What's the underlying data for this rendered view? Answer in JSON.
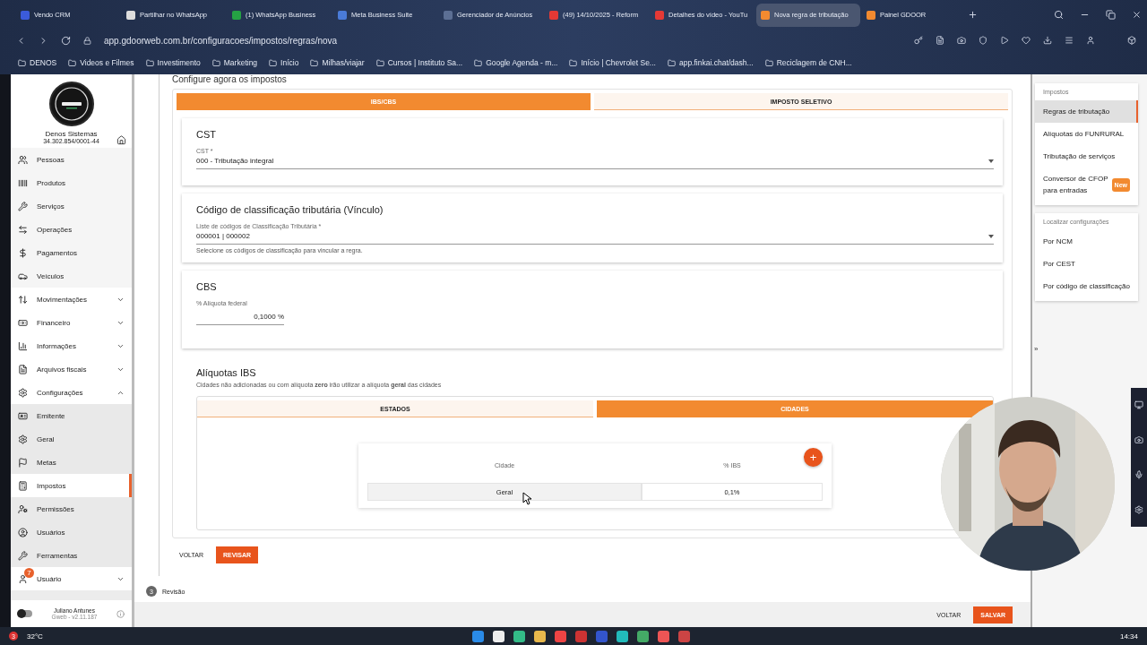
{
  "browser": {
    "tabs": [
      {
        "label": "Vendo CRM",
        "selected": false,
        "color": "#3b5bdb"
      },
      {
        "label": "Partilhar no WhatsApp",
        "selected": false,
        "color": "#dddddd"
      },
      {
        "label": "(1) WhatsApp Business",
        "selected": false,
        "color": "#25a244"
      },
      {
        "label": "Meta Business Suite",
        "selected": false,
        "color": "#4a7bd8"
      },
      {
        "label": "Gerenciador de Anúncios",
        "selected": false,
        "color": "#5c6f94"
      },
      {
        "label": "(49) 14/10/2025 - Reform",
        "selected": false,
        "color": "#e53935"
      },
      {
        "label": "Detalhes do vídeo - YouTu",
        "selected": false,
        "color": "#e53935"
      },
      {
        "label": "Nova regra de tributação",
        "selected": true,
        "color": "#f28a30"
      },
      {
        "label": "Painel GDOOR",
        "selected": false,
        "color": "#f28a30"
      }
    ],
    "url": "app.gdoorweb.com.br/configuracoes/impostos/regras/nova",
    "bookmarks": [
      "DENOS",
      "Videos e Filmes",
      "Investimento",
      "Marketing",
      "Início",
      "Milhas/viajar",
      "Cursos | Instituto Sa...",
      "Google Agenda - m...",
      "Início | Chevrolet Se...",
      "app.finkai.chat/dash...",
      "Reciclagem de CNH..."
    ]
  },
  "sidebar": {
    "company": "Denos Sistemas",
    "cnpj": "34.302.854/0001-44",
    "items": [
      {
        "label": "Pessoas",
        "kind": "link",
        "selected": false
      },
      {
        "label": "Produtos",
        "kind": "link",
        "selected": false
      },
      {
        "label": "Serviços",
        "kind": "link",
        "selected": false
      },
      {
        "label": "Operações",
        "kind": "link",
        "selected": false
      },
      {
        "label": "Pagamentos",
        "kind": "link",
        "selected": false
      },
      {
        "label": "Veículos",
        "kind": "link",
        "selected": false
      },
      {
        "label": "Movimentações",
        "kind": "group",
        "expanded": false
      },
      {
        "label": "Financeiro",
        "kind": "group",
        "expanded": false
      },
      {
        "label": "Informações",
        "kind": "group",
        "expanded": false
      },
      {
        "label": "Arquivos fiscais",
        "kind": "group",
        "expanded": false
      },
      {
        "label": "Configurações",
        "kind": "group",
        "expanded": true,
        "children": [
          {
            "label": "Emitente",
            "selected": false
          },
          {
            "label": "Geral",
            "selected": false
          },
          {
            "label": "Metas",
            "selected": false
          },
          {
            "label": "Impostos",
            "selected": true
          },
          {
            "label": "Permissões",
            "selected": false
          },
          {
            "label": "Usuários",
            "selected": false
          },
          {
            "label": "Ferramentas",
            "selected": false
          }
        ]
      },
      {
        "label": "Usuário",
        "kind": "group",
        "expanded": false,
        "badge": "7"
      }
    ],
    "dark_mode": false,
    "user": "Juliano Antunes",
    "version": "Gweb - v2.11.187"
  },
  "main": {
    "heading": "Configure agora os impostos",
    "tabs": [
      {
        "label": "IBS/CBS",
        "selected": true
      },
      {
        "label": "IMPOSTO SELETIVO",
        "selected": false
      }
    ],
    "cst": {
      "title": "CST",
      "label": "CST *",
      "value": "000 - Tributação integral"
    },
    "vinculo": {
      "title": "Código de classificação tributária (Vínculo)",
      "label": "Liste de códigos de Classificação Tributária *",
      "value": "000001 | 000002",
      "helper": "Selecione os códigos de classificação para vincular a regra."
    },
    "cbs": {
      "title": "CBS",
      "label": "% Alíquota federal",
      "value": "0,1000 %"
    },
    "ibs": {
      "title": "Alíquotas IBS",
      "description": "Cidades não adicionadas ou com alíquota **zero** irão utilizar a alíquota **geral** das cidades",
      "tabs": [
        {
          "label": "ESTADOS",
          "selected": false
        },
        {
          "label": "CIDADES",
          "selected": true
        }
      ],
      "add_button": "+",
      "table": {
        "columns": [
          "Cidade",
          "% IBS"
        ],
        "rows": [
          [
            "Geral",
            "0,1%"
          ]
        ]
      }
    },
    "buttons": [
      "VOLTAR",
      "REVISAR"
    ],
    "step": {
      "number": "3",
      "label": "Revisão"
    },
    "footer_buttons": [
      "VOLTAR",
      "SALVAR"
    ]
  },
  "right_panel": {
    "groups": [
      {
        "title": "Impostos",
        "items": [
          {
            "label": "Regras de tributação",
            "selected": true
          },
          {
            "label": "Alíquotas do FUNRURAL",
            "selected": false
          },
          {
            "label": "Tributação de serviços",
            "selected": false
          },
          {
            "label": "Conversor de CFOP para entradas",
            "selected": false,
            "badge": "New"
          }
        ]
      },
      {
        "title": "Localizar configurações",
        "items": [
          {
            "label": "Por NCM",
            "selected": false
          },
          {
            "label": "Por CEST",
            "selected": false
          },
          {
            "label": "Por código de classificação",
            "selected": false
          }
        ]
      }
    ],
    "collapse": "»"
  },
  "taskbar": {
    "alerts": "3",
    "weather": "32°C",
    "time": "14:34"
  }
}
